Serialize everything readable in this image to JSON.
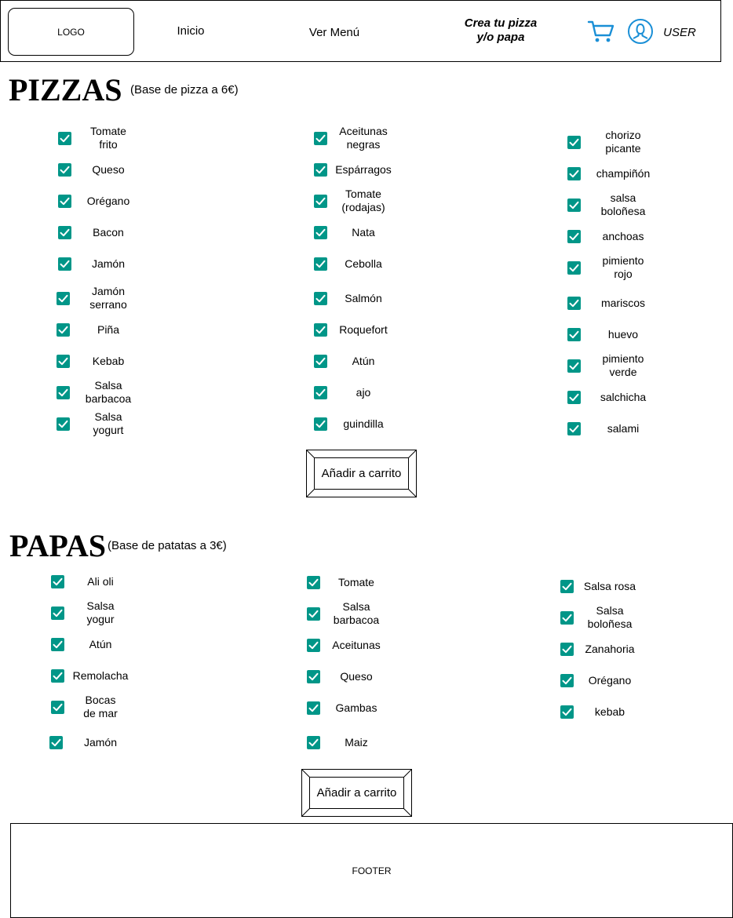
{
  "header": {
    "logo": "LOGO",
    "nav_inicio": "Inicio",
    "nav_menu": "Ver Menú",
    "nav_crea": "Crea tu pizza\ny/o papa",
    "user": "USER"
  },
  "pizzas": {
    "title": "PIZZAS",
    "subtitle": "(Base de pizza a 6€)",
    "columns": [
      [
        "Tomate\nfrito",
        "Queso",
        "Orégano",
        "Bacon",
        "Jamón",
        "Jamón\nserrano",
        "Piña",
        "Kebab",
        "Salsa\nbarbacoa",
        "Salsa\nyogurt"
      ],
      [
        "Aceitunas\nnegras",
        "Espárragos",
        "Tomate\n(rodajas)",
        "Nata",
        "Cebolla",
        "Salmón",
        "Roquefort",
        "Atún",
        "ajo",
        "guindilla"
      ],
      [
        "chorizo\npicante",
        "champiñón",
        "salsa\nboloñesa",
        "anchoas",
        "pimiento\nrojo",
        "mariscos",
        "huevo",
        "pimiento\nverde",
        "salchicha",
        "salami"
      ]
    ],
    "checked": true,
    "add_button": "Añadir a carrito"
  },
  "papas": {
    "title": "PAPAS",
    "subtitle": "(Base de patatas a 3€)",
    "columns": [
      [
        "Ali oli",
        "Salsa\nyogur",
        "Atún",
        "Remolacha",
        "Bocas\nde mar",
        "Jamón"
      ],
      [
        "Tomate",
        "Salsa\nbarbacoa",
        "Aceitunas",
        "Queso",
        "Gambas",
        "Maiz"
      ],
      [
        "Salsa rosa",
        "Salsa\nboloñesa",
        "Zanahoria",
        "Orégano",
        "kebab"
      ]
    ],
    "checked": true,
    "add_button": "Añadir a carrito"
  },
  "footer": {
    "label": "FOOTER"
  },
  "colors": {
    "checkbox": "#009688",
    "icon": "#1a8fd6"
  },
  "icons": {
    "cart": "cart-icon",
    "user": "user-icon"
  }
}
